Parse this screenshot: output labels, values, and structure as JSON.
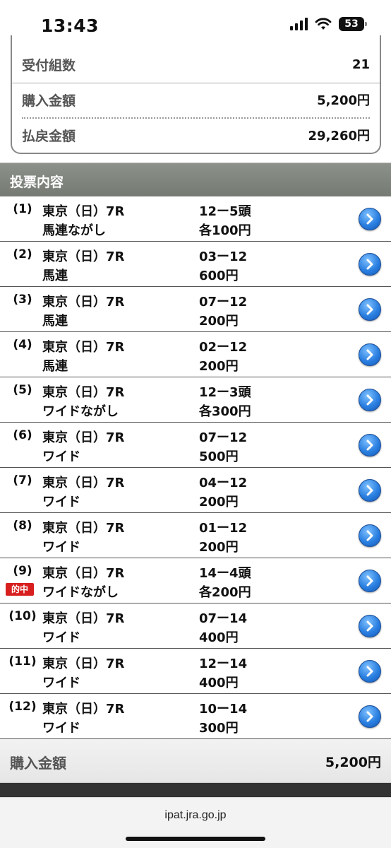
{
  "status_bar": {
    "time": "13:43",
    "battery": "53"
  },
  "summary": {
    "rows": [
      {
        "label": "受付組数",
        "value": "21"
      },
      {
        "label": "購入金額",
        "value": "5,200円"
      },
      {
        "label": "払戻金額",
        "value": "29,260円"
      }
    ]
  },
  "section_title": "投票内容",
  "bets": [
    {
      "num": "(1)",
      "race": "東京（日）7R",
      "type": "馬連ながし",
      "combo": "12ー5頭",
      "amount": "各100円",
      "hit": ""
    },
    {
      "num": "(2)",
      "race": "東京（日）7R",
      "type": "馬連",
      "combo": "03ー12",
      "amount": "600円",
      "hit": ""
    },
    {
      "num": "(3)",
      "race": "東京（日）7R",
      "type": "馬連",
      "combo": "07ー12",
      "amount": "200円",
      "hit": ""
    },
    {
      "num": "(4)",
      "race": "東京（日）7R",
      "type": "馬連",
      "combo": "02ー12",
      "amount": "200円",
      "hit": ""
    },
    {
      "num": "(5)",
      "race": "東京（日）7R",
      "type": "ワイドながし",
      "combo": "12ー3頭",
      "amount": "各300円",
      "hit": ""
    },
    {
      "num": "(6)",
      "race": "東京（日）7R",
      "type": "ワイド",
      "combo": "07ー12",
      "amount": "500円",
      "hit": ""
    },
    {
      "num": "(7)",
      "race": "東京（日）7R",
      "type": "ワイド",
      "combo": "04ー12",
      "amount": "200円",
      "hit": ""
    },
    {
      "num": "(8)",
      "race": "東京（日）7R",
      "type": "ワイド",
      "combo": "01ー12",
      "amount": "200円",
      "hit": ""
    },
    {
      "num": "(9)",
      "race": "東京（日）7R",
      "type": "ワイドながし",
      "combo": "14ー4頭",
      "amount": "各200円",
      "hit": "的中"
    },
    {
      "num": "(10)",
      "race": "東京（日）7R",
      "type": "ワイド",
      "combo": "07ー14",
      "amount": "400円",
      "hit": ""
    },
    {
      "num": "(11)",
      "race": "東京（日）7R",
      "type": "ワイド",
      "combo": "12ー14",
      "amount": "400円",
      "hit": ""
    },
    {
      "num": "(12)",
      "race": "東京（日）7R",
      "type": "ワイド",
      "combo": "10ー14",
      "amount": "300円",
      "hit": ""
    }
  ],
  "footer": {
    "label": "購入金額",
    "value": "5,200円"
  },
  "browser": {
    "url": "ipat.jra.go.jp"
  },
  "colors": {
    "header_bg": "#7f847d",
    "hit_badge": "#d81f1f",
    "detail_button": "#2a7fe0"
  },
  "icons": {
    "detail": "chevron-right-icon",
    "signal": "cellular-signal-icon",
    "wifi": "wifi-icon",
    "battery": "battery-icon"
  }
}
